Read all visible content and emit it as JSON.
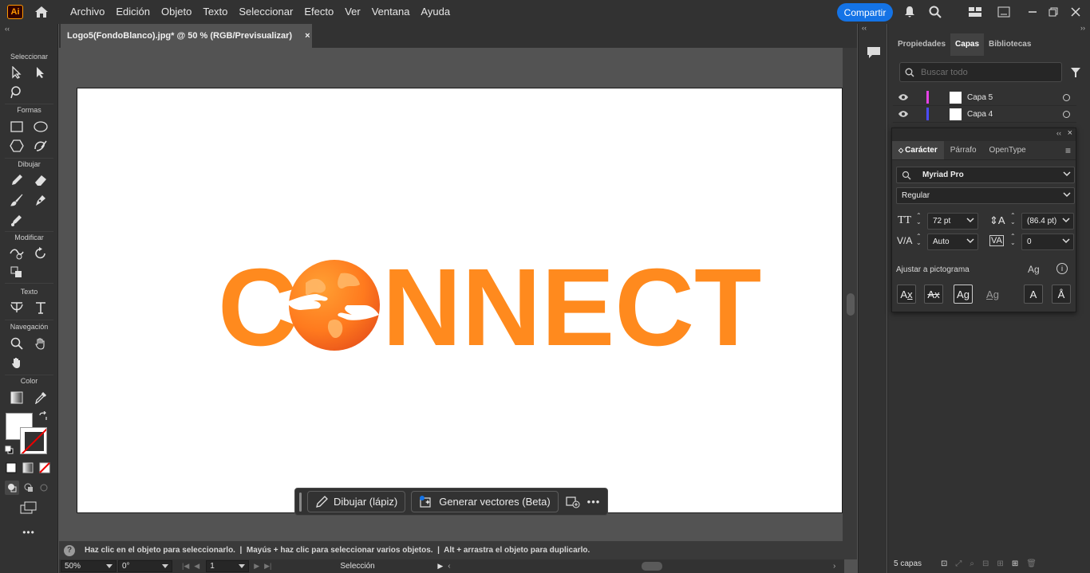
{
  "menubar": {
    "app_icon": "Ai",
    "items": [
      "Archivo",
      "Edición",
      "Objeto",
      "Texto",
      "Seleccionar",
      "Efecto",
      "Ver",
      "Ventana",
      "Ayuda"
    ],
    "share_label": "Compartir"
  },
  "toolbar": {
    "sections": [
      "Seleccionar",
      "Formas",
      "Dibujar",
      "Modificar",
      "Texto",
      "Navegación",
      "Color"
    ]
  },
  "document": {
    "tab_title": "Logo5(FondoBlanco).jpg* @ 50 % (RGB/Previsualizar)",
    "close_glyph": "×"
  },
  "artwork": {
    "logo_text_prefix": "C",
    "logo_text_suffix": "NNECT",
    "colors": {
      "logo_orange": "#ff8a1e",
      "globe_dark": "#e8641a"
    }
  },
  "taskbar": {
    "draw_label": "Dibujar (lápiz)",
    "generate_label": "Generar vectores (Beta)",
    "more_glyph": "•••"
  },
  "status": {
    "message": "Haz clic en el objeto para seleccionarlo.  |  Mayús + haz clic para seleccionar varios objetos.  |  Alt + arrastra el objeto para duplicarlo.",
    "zoom": "50%",
    "rotation": "0°",
    "artboard_number": "1",
    "tool_name": "Selección"
  },
  "right_panel": {
    "tabs": [
      "Propiedades",
      "Capas",
      "Bibliotecas"
    ],
    "active_tab": "Capas",
    "search_placeholder": "Buscar todo",
    "layers": [
      {
        "name": "Capa 5",
        "color": "#e542e5"
      },
      {
        "name": "Capa 4",
        "color": "#4b4bff"
      }
    ],
    "footer": "5 capas"
  },
  "character_panel": {
    "tabs": [
      "Carácter",
      "Párrafo",
      "OpenType"
    ],
    "font_family": "Myriad Pro",
    "font_style": "Regular",
    "font_size": "72 pt",
    "leading": "(86.4 pt)",
    "kerning": "Auto",
    "tracking": "0",
    "snap_label": "Ajustar a pictograma"
  }
}
